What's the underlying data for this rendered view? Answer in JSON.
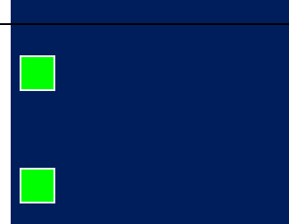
{
  "colors": {
    "panel_background": "#011e5c",
    "tile_fill": "#00ff00",
    "tile_border": "#ffffff",
    "header_line": "#000000"
  },
  "tiles": [
    {
      "icon": "green-square-tile"
    },
    {
      "icon": "green-square-tile"
    }
  ]
}
